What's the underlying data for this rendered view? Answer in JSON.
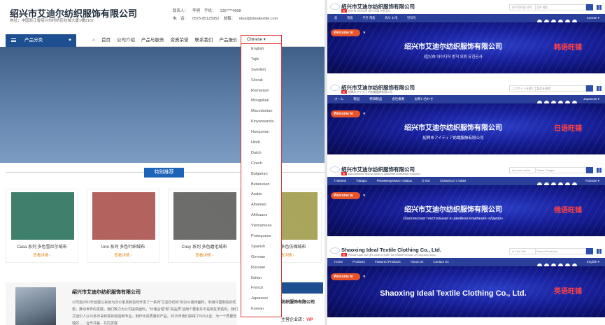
{
  "left": {
    "company_title": "绍兴市艾迪尔纺织服饰有限公司",
    "address": "地址：中国浙江省绍兴市柯桥区纺城大厦1幢2102",
    "contact_line1": [
      "联系人：",
      "李明",
      "手机：",
      "135****4698"
    ],
    "contact_line2": [
      "电　话：",
      "0575-85125952",
      "邮箱：",
      "ideal@idealtextile.com"
    ],
    "category_button": "产品分类",
    "nav_items": [
      "首页",
      "公司介绍",
      "产品与服务",
      "资质荣誉",
      "联系我们",
      "产品报价"
    ],
    "language_selected": "Chinese",
    "languages": [
      "English",
      "Tajik",
      "Swedish",
      "Slovak",
      "Romanian",
      "Mongolian",
      "Macedonian",
      "Kinyarwanda",
      "Hungarian",
      "Hindi",
      "Dutch",
      "Czech",
      "Bulgarian",
      "Belarusian",
      "Arabic",
      "Albanian",
      "Afrikaans",
      "Vietnamese",
      "Portuguese",
      "Spanish",
      "German",
      "Russian",
      "Italian",
      "French",
      "Japanese",
      "Korean"
    ],
    "featured_label": "特别推荐",
    "products": [
      {
        "name": "Casa 系列 多色雪尼尔绒布",
        "link": "查看详情 ›",
        "color": "#3c7d6a"
      },
      {
        "name": "Uno 系列 多色针织绒布",
        "link": "查看详情 ›",
        "color": "#b2605c"
      },
      {
        "name": "Cosy 系列 多色磨毛绒布",
        "link": "查看详情 ›",
        "color": "#6a6a68"
      },
      {
        "name": "Bo 系列 多色仿棉绒布",
        "link": "查看详情 ›",
        "color": "#a9a45a"
      }
    ],
    "about_title": "绍兴市艾迪尔纺织服饰有限公司",
    "about_text": "公司自2002年创建以来就为办公家具制造商开发了一系列\"艾迪尔纺织\"的办公装饰面料。利用中国制造的优势，推动世界的发展，我们致力为公司提供面料，\"价格合理\"和\"高品质\"这两个要素并不是相互矛盾的。我们艾迪尔人以20多年来积累的经验和专业，制作出高质量的产品，2015年我们获得了ISO认证，为一个质量管理的……合作共赢，共同发展",
    "side_title": "纺织服饰有限公司",
    "side_member": "主营企业店：",
    "side_vip": "VIP"
  },
  "right": {
    "panels": [
      {
        "title": "绍兴市艾迪尔纺织服饰有限公司",
        "sub": "绍兴市 아이디어 방직 의류 유한공사",
        "search_scope": "제 이전마을 선택",
        "search_placeholder": "검색 제품",
        "nav": [
          "홈",
          "제품",
          "추천 제품",
          "회사 소개",
          "연락처"
        ],
        "lang": "Korean ▾",
        "welcome": "Welcome to",
        "banner_title": "绍兴市艾迪尔纺织服饰有限公司",
        "banner_sub": "绍兴市 아이디어 방직 의류 유한공사",
        "tag": "韩语旺铺"
      },
      {
        "title": "绍兴市艾迪尔纺织服饰有限公司",
        "sub": "紹興市アイディア紡織服飾有限公司",
        "search_scope": "このサイトを選ぶ",
        "search_placeholder": "製品を検索",
        "nav": [
          "ホーム",
          "製品",
          "特価製品",
          "会社概要",
          "お問い合わせ"
        ],
        "lang": "Japanese ▾",
        "welcome": "Welcome to",
        "banner_title": "绍兴市艾迪尔纺织服饰有限公司",
        "banner_sub": "紹興市アイディア紡織服飾有限公司",
        "tag": "日语旺铺"
      },
      {
        "title": "绍兴市艾迪尔纺织服饰有限公司",
        "sub": "Шаосинская текстильная и швейная компания «Идиэр»",
        "search_scope": "На этом сайте",
        "search_placeholder": "Поиск Товары",
        "nav": [
          "Главная",
          "Товары",
          "Рекомендуемые товары",
          "О нас",
          "Связаться с нами"
        ],
        "lang": "Russian ▾",
        "welcome": "Welcome to",
        "banner_title": "绍兴市艾迪尔纺织服饰有限公司",
        "banner_sub": "Шаосинская текстильная и швейная компания «Идиэр»",
        "tag": "俄语旺铺"
      },
      {
        "title": "Shaoxing Ideal Textile Clothing Co., Ltd.",
        "sub": "Please scan the QR code to enter the Mobile version of company shop.",
        "search_scope": "In This Site",
        "search_placeholder": "Search Products",
        "nav": [
          "Home",
          "Products",
          "Featured Products",
          "About Us",
          "Contact Us"
        ],
        "lang": "English ▾",
        "welcome": "Welcome to",
        "banner_title": "Shaoxing Ideal Textile Clothing Co., Ltd.",
        "banner_sub": "",
        "tag": "英语旺铺"
      }
    ]
  }
}
